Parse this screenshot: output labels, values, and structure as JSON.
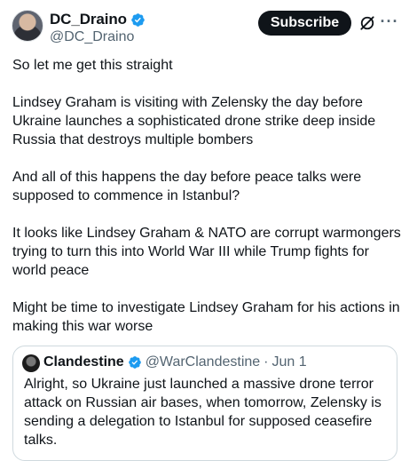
{
  "author": {
    "display_name": "DC_Draino",
    "handle": "@DC_Draino"
  },
  "actions": {
    "subscribe_label": "Subscribe",
    "grok_icon": "grok-icon",
    "more_icon": "more-icon"
  },
  "tweet": {
    "paragraphs": [
      "So let me get this straight",
      "Lindsey Graham is visiting with Zelensky the day before Ukraine launches a sophisticated drone strike deep inside Russia that destroys multiple bombers",
      "And all of this happens the day before peace talks were supposed to commence in Istanbul?",
      "It looks like Lindsey Graham & NATO are corrupt warmongers trying to turn this into World War III while Trump fights for world peace",
      "Might be time to investigate Lindsey Graham for his actions in making this war worse"
    ]
  },
  "quoted": {
    "display_name": "Clandestine",
    "handle": "@WarClandestine",
    "separator": "·",
    "date": "Jun 1",
    "text": "Alright, so Ukraine just launched a massive drone terror attack on Russian air bases, when tomorrow, Zelensky is sending a delegation to Istanbul for supposed ceasefire talks."
  },
  "colors": {
    "verified_blue": "#1d9bf0",
    "secondary_text": "#536471",
    "primary_text": "#0f1419",
    "button_bg": "#0f1419",
    "border": "#cfd9de"
  }
}
